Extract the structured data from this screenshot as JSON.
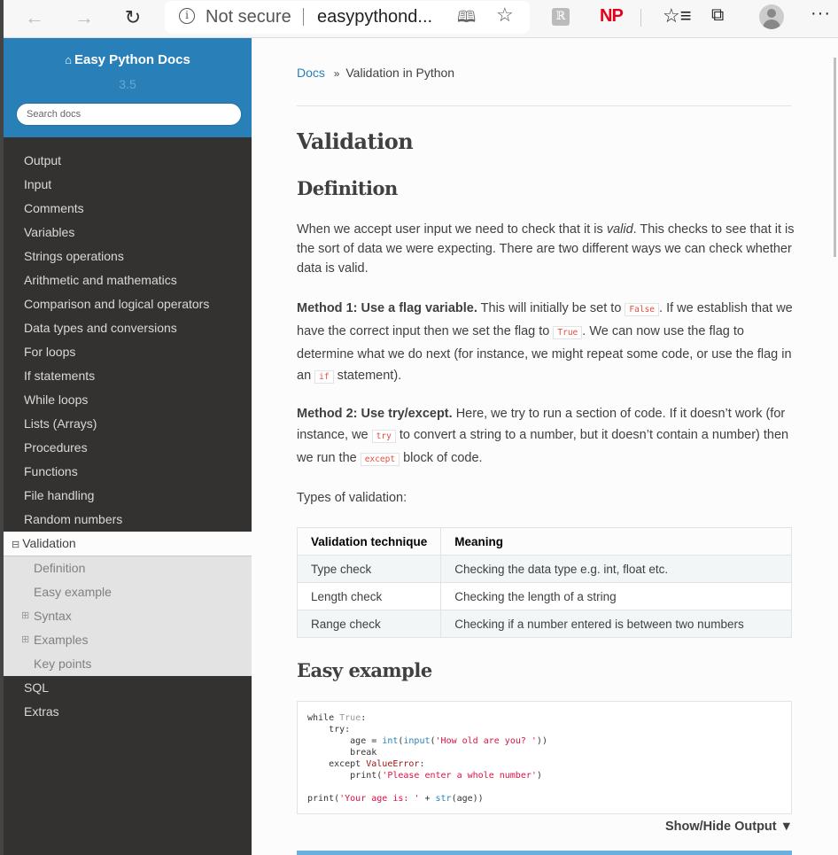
{
  "browser": {
    "back": "←",
    "forward": "→",
    "reload": "↻",
    "security_label": "Not secure",
    "url": "easypythond...",
    "read_aloud_icon": "read-aloud",
    "add_favorite_icon": "☆",
    "extension_r": "ℝ",
    "extension_np": "NP",
    "favorites_icon": "☆≡",
    "collections_icon": "⧉",
    "more_icon": "···"
  },
  "sidebar": {
    "brand": "Easy Python Docs",
    "version": "3.5",
    "search_placeholder": "Search docs",
    "items": [
      {
        "label": "Output"
      },
      {
        "label": "Input"
      },
      {
        "label": "Comments"
      },
      {
        "label": "Variables"
      },
      {
        "label": "Strings operations"
      },
      {
        "label": "Arithmetic and mathematics"
      },
      {
        "label": "Comparison and logical operators"
      },
      {
        "label": "Data types and conversions"
      },
      {
        "label": "For loops"
      },
      {
        "label": "If statements"
      },
      {
        "label": "While loops"
      },
      {
        "label": "Lists (Arrays)"
      },
      {
        "label": "Procedures"
      },
      {
        "label": "Functions"
      },
      {
        "label": "File handling"
      },
      {
        "label": "Random numbers"
      }
    ],
    "current": {
      "label": "Validation",
      "toggle": "⊟",
      "children": [
        {
          "label": "Definition",
          "toggle": ""
        },
        {
          "label": "Easy example",
          "toggle": ""
        },
        {
          "label": "Syntax",
          "toggle": "⊞"
        },
        {
          "label": "Examples",
          "toggle": "⊞"
        },
        {
          "label": "Key points",
          "toggle": ""
        }
      ]
    },
    "items_after": [
      {
        "label": "SQL"
      },
      {
        "label": "Extras"
      }
    ]
  },
  "content": {
    "breadcrumb": {
      "root": "Docs",
      "separator": "»",
      "current": "Validation in Python"
    },
    "title": "Validation",
    "definition_heading": "Definition",
    "definition_text_1": "When we accept user input we need to check that it is ",
    "definition_em": "valid",
    "definition_text_2": ". This checks to see that it is the sort of data we were expecting. There are two different ways we can check whether data is valid.",
    "method1": {
      "bold": "Method 1: Use a flag variable.",
      "t1": " This will initially be set to ",
      "c1": "False",
      "t2": ". If we establish that we have the correct input then we set the flag to ",
      "c2": "True",
      "t3": ". We can now use the flag to determine what we do next (for instance, we might repeat some code, or use the flag in an ",
      "c3": "if",
      "t4": " statement)."
    },
    "method2": {
      "bold": "Method 2: Use try/except.",
      "t1": " Here, we try to run a section of code. If it doesn’t work (for instance, we ",
      "c1": "try",
      "t2": " to convert a string to a number, but it doesn’t contain a number) then we run the ",
      "c2": "except",
      "t3": " block of code."
    },
    "types_label": "Types of validation:",
    "table": {
      "headers": [
        "Validation technique",
        "Meaning"
      ],
      "rows": [
        [
          "Type check",
          "Checking the data type e.g. int, float etc."
        ],
        [
          "Length check",
          "Checking the length of a string"
        ],
        [
          "Range check",
          "Checking if a number entered is between two numbers"
        ]
      ]
    },
    "easy_example_heading": "Easy example",
    "code": {
      "l1_kw": "while",
      "l1_c": " True",
      "l1_p": ":",
      "l2": "    try:",
      "l3_a": "        age = ",
      "l3_int": "int",
      "l3_p1": "(",
      "l3_input": "input",
      "l3_p2": "(",
      "l3_s": "'How old are you? '",
      "l3_p3": "))",
      "l4": "        break",
      "l5_a": "    except ",
      "l5_e": "ValueError",
      "l5_p": ":",
      "l6_a": "        print(",
      "l6_s": "'Please enter a whole number'",
      "l6_p": ")",
      "l8_a": "print(",
      "l8_s": "'Your age is: '",
      "l8_b": " + ",
      "l8_str": "str",
      "l8_c": "(age))"
    },
    "show_hide": "Show/Hide Output ▼"
  }
}
